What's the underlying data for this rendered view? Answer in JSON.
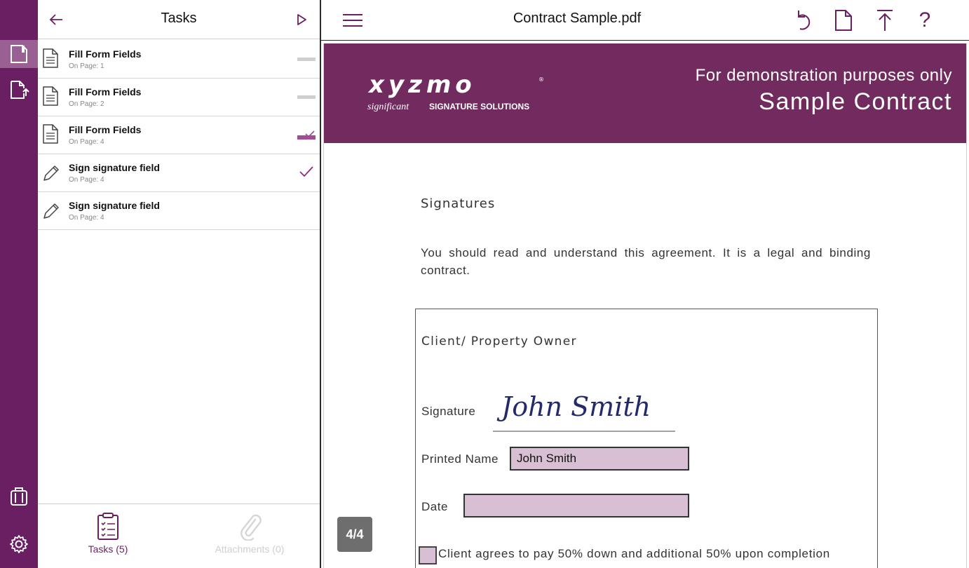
{
  "colors": {
    "brand": "#6b1f63",
    "accent": "#8a2f7e",
    "field_fill": "#d9bfd3",
    "banner": "#722b5f"
  },
  "rail": {
    "items": [
      {
        "icon": "document-icon",
        "active": true
      },
      {
        "icon": "document-upload-icon",
        "active": false
      },
      {
        "icon": "clipboard-icon",
        "active": false
      },
      {
        "icon": "gear-icon",
        "active": false
      }
    ]
  },
  "tasks_panel": {
    "title": "Tasks",
    "items": [
      {
        "icon": "document-icon",
        "title": "Fill Form Fields",
        "subtitle": "On Page: 1",
        "status": "pending"
      },
      {
        "icon": "document-icon",
        "title": "Fill Form Fields",
        "subtitle": "On Page: 2",
        "status": "pending"
      },
      {
        "icon": "document-icon",
        "title": "Fill Form Fields",
        "subtitle": "On Page: 4",
        "status": "partial"
      },
      {
        "icon": "pencil-icon",
        "title": "Sign signature field",
        "subtitle": "On Page: 4",
        "status": "done"
      },
      {
        "icon": "pencil-icon",
        "title": "Sign signature field",
        "subtitle": "On Page: 4",
        "status": "none"
      }
    ],
    "footer": {
      "tasks_label": "Tasks (5)",
      "attachments_label": "Attachments (0)"
    }
  },
  "viewer": {
    "title": "Contract Sample.pdf",
    "toolbar": [
      "undo-icon",
      "document-icon",
      "upload-icon",
      "help-icon"
    ],
    "help_glyph": "?",
    "page_indicator": "4/4"
  },
  "document": {
    "logo_word": "xyzmo",
    "logo_tagline_a": "significant",
    "logo_tagline_b": "SIGNATURE SOLUTIONS",
    "logo_reg": "®",
    "demo_text": "For demonstration purposes only",
    "banner_title": "Sample Contract",
    "section_heading": "Signatures",
    "paragraph": "You should read and understand this agreement. It is a legal and binding contract.",
    "box_heading": "Client/ Property Owner",
    "signature_label": "Signature",
    "printed_name_label": "Printed Name",
    "printed_name_value": "John Smith",
    "date_label": "Date",
    "date_value": "",
    "signature_text": "John Smith",
    "agreement_text": "Client agrees to pay 50% down and additional 50% upon completion"
  }
}
